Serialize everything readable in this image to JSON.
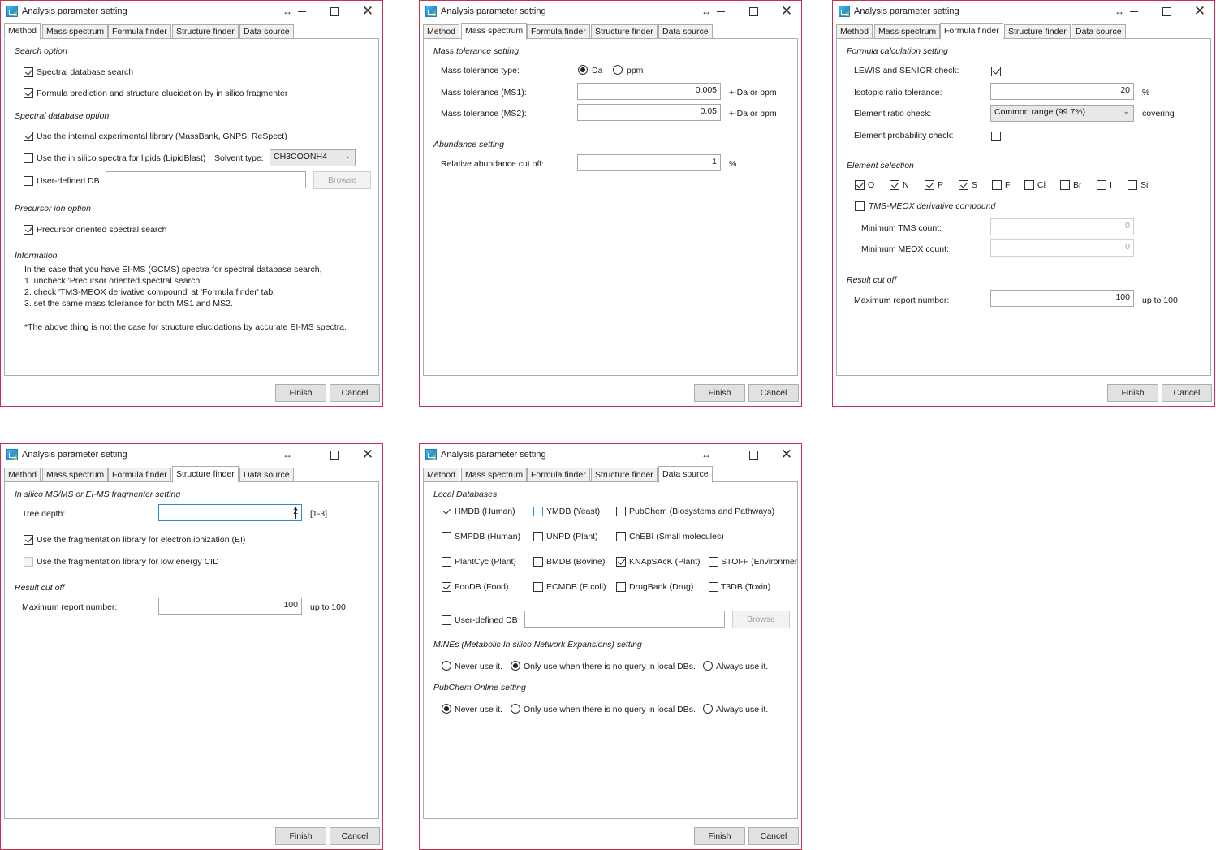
{
  "window": {
    "title": "Analysis parameter setting",
    "resize_glyph": "↔",
    "close_glyph": "✕",
    "finish_label": "Finish",
    "cancel_label": "Cancel"
  },
  "tabs": {
    "method": "Method",
    "mass": "Mass spectrum",
    "formula": "Formula finder",
    "structure": "Structure finder",
    "datasource": "Data source"
  },
  "method": {
    "search_option": "Search option",
    "spectral_db_search": "Spectral database search",
    "formula_prediction": "Formula prediction and structure elucidation by in silico fragmenter",
    "spectral_db_option": "Spectral database option",
    "internal_library": "Use the internal experimental library (MassBank, GNPS, ReSpect)",
    "insilico_lipids": "Use the in silico spectra for lipids (LipidBlast)",
    "solvent_type_label": "Solvent type:",
    "solvent_type_value": "CH3COONH4",
    "user_defined_db": "User-defined DB",
    "browse": "Browse",
    "precursor_option": "Precursor ion option",
    "precursor_search": "Precursor oriented spectral search",
    "information": "Information",
    "info_lines": [
      "In the case that you have EI-MS (GCMS) spectra for spectral database search,",
      "1. uncheck 'Precursor oriented spectral search'",
      "2. check 'TMS-MEOX derivative compound' at 'Formula finder' tab.",
      "3. set the same mass tolerance for both MS1 and MS2."
    ],
    "note": "*The above thing is not the case for structure elucidations by accurate EI-MS spectra."
  },
  "mass": {
    "tolerance_setting": "Mass tolerance setting",
    "tolerance_type": "Mass tolerance type:",
    "da": "Da",
    "ppm": "ppm",
    "ms1_label": "Mass tolerance (MS1):",
    "ms1_value": "0.005",
    "ms2_label": "Mass tolerance (MS2):",
    "ms2_value": "0.05",
    "unit": "+-Da or ppm",
    "abundance_setting": "Abundance setting",
    "relative_cutoff": "Relative abundance cut off:",
    "relative_value": "1",
    "percent": "%"
  },
  "formula": {
    "calc_setting": "Formula calculation setting",
    "lewis_senior": "LEWIS and SENIOR check:",
    "isotopic_ratio": "Isotopic ratio tolerance:",
    "isotopic_value": "20",
    "percent": "%",
    "element_ratio": "Element ratio check:",
    "element_ratio_value": "Common range (99.7%)",
    "covering": "covering",
    "element_probability": "Element probability check:",
    "element_selection": "Element selection",
    "elements": [
      "O",
      "N",
      "P",
      "S",
      "F",
      "Cl",
      "Br",
      "I",
      "Si"
    ],
    "tms_meox": "TMS-MEOX derivative compound",
    "min_tms": "Minimum TMS count:",
    "min_tms_value": "0",
    "min_meox": "Minimum MEOX count:",
    "min_meox_value": "0",
    "result_cutoff": "Result cut off",
    "max_report": "Maximum report number:",
    "max_report_value": "100",
    "up_to": "up to 100"
  },
  "structure": {
    "fragmenter_setting": "In silico MS/MS or EI-MS fragmenter setting",
    "tree_depth": "Tree depth:",
    "tree_depth_value": "2",
    "tree_depth_range": "[1-3]",
    "ei_library": "Use the fragmentation library for electron ionization (EI)",
    "cid_library": "Use the fragmentation library for low energy CID",
    "result_cutoff": "Result cut off",
    "max_report": "Maximum report number:",
    "max_report_value": "100",
    "up_to": "up to 100"
  },
  "datasource": {
    "local_databases": "Local Databases",
    "dbs": {
      "hmdb": "HMDB (Human)",
      "ymdb": "YMDB (Yeast)",
      "pubchem": "PubChem (Biosystems and Pathways)",
      "smpdb": "SMPDB (Human)",
      "unpd": "UNPD (Plant)",
      "chebi": "ChEBI (Small molecules)",
      "plantcyc": "PlantCyc (Plant)",
      "bmdb": "BMDB (Bovine)",
      "knapsack": "KNApSAcK (Plant)",
      "stoff": "STOFF (Environment)",
      "foodb": "FooDB (Food)",
      "ecmdb": "ECMDB (E.coli)",
      "drugbank": "DrugBank (Drug)",
      "t3db": "T3DB (Toxin)"
    },
    "user_defined_db": "User-defined DB",
    "browse": "Browse",
    "mines_setting": "MINEs (Metabolic In silico Network Expansions) setting",
    "pubchem_online": "PubChem Online setting",
    "never": "Never use it.",
    "only_when": "Only use when there is no query in local DBs.",
    "always": "Always use it."
  }
}
